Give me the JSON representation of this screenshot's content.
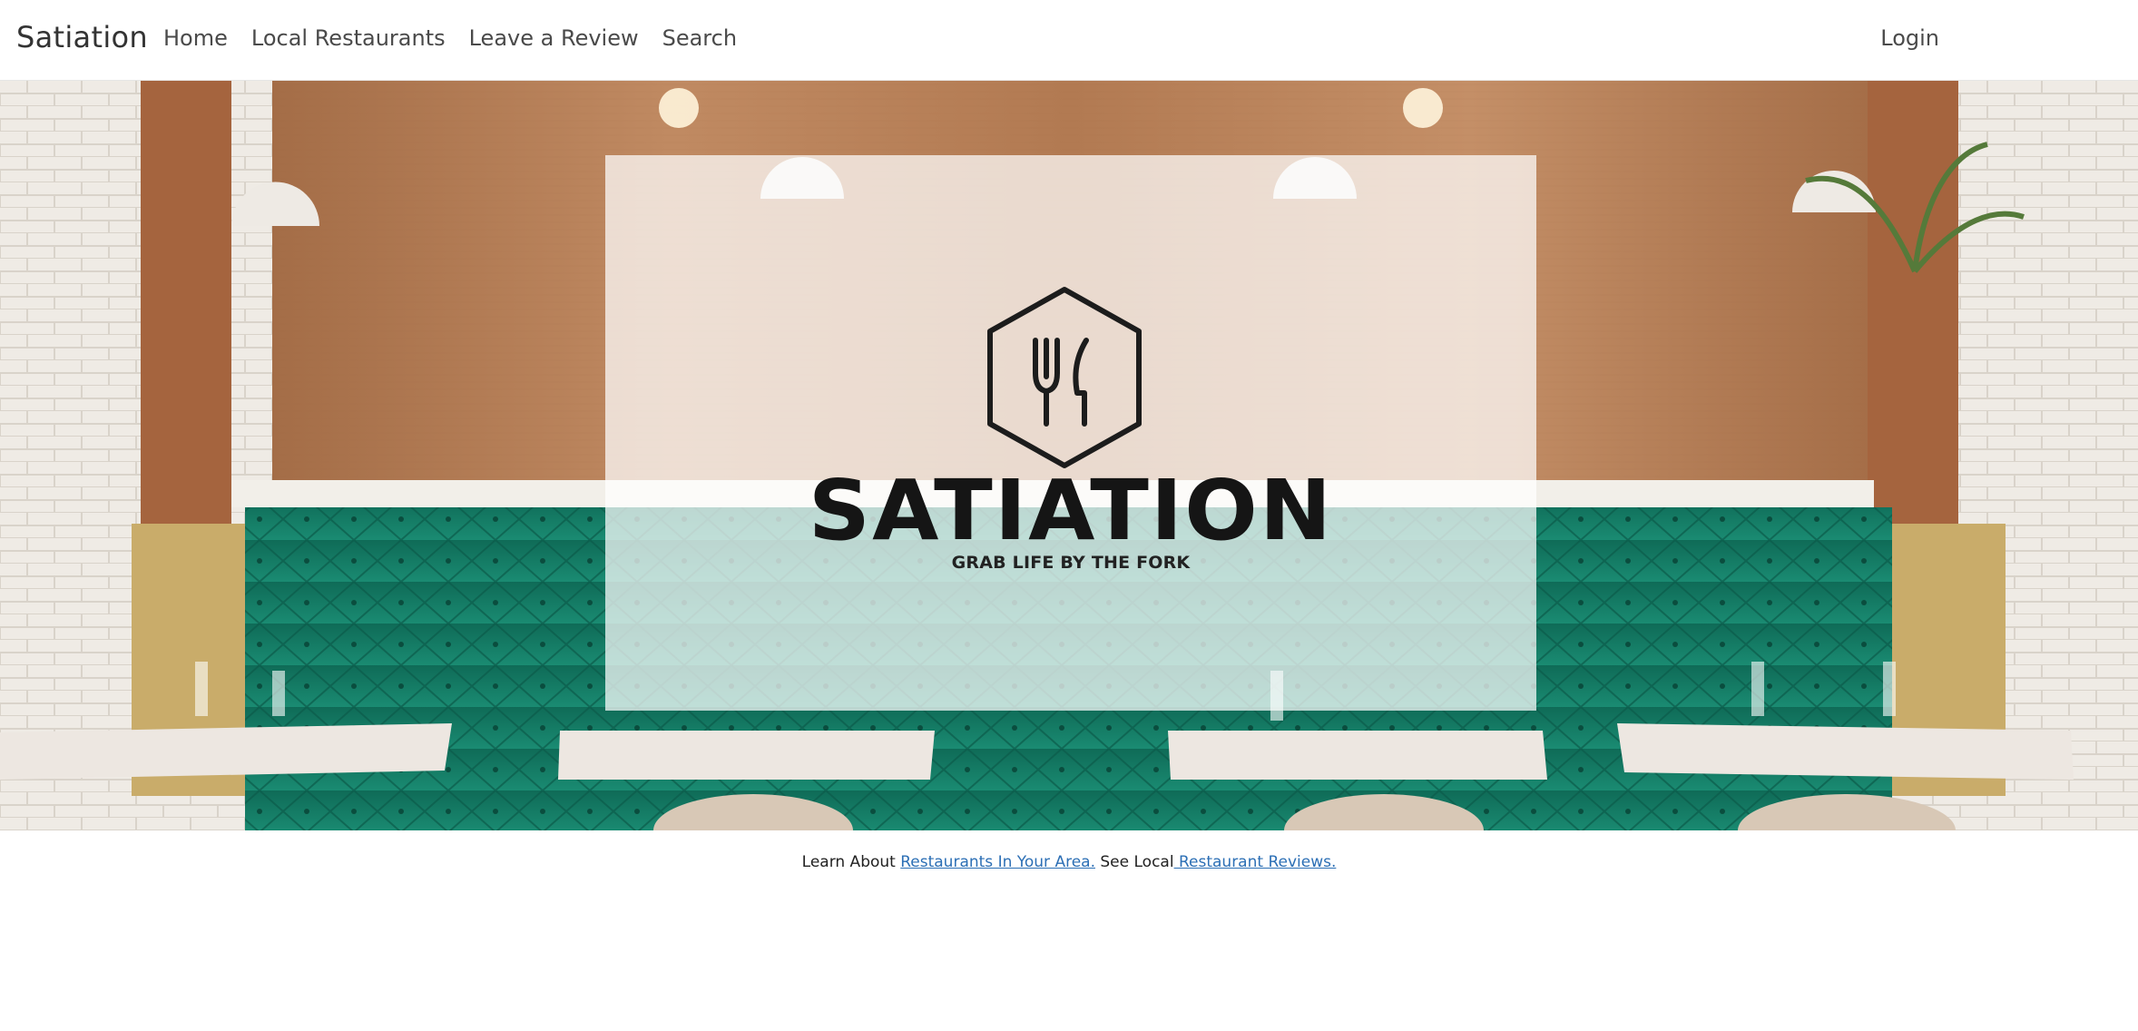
{
  "navbar": {
    "brand": "Satiation",
    "links": [
      "Home",
      "Local Restaurants",
      "Leave a Review",
      "Search"
    ],
    "login": "Login"
  },
  "hero": {
    "logo_text": "SATIATION",
    "tagline": "GRAB LIFE BY THE FORK",
    "icon": "fork-knife-hexagon-icon"
  },
  "intro": {
    "prefix": "Learn About ",
    "link1": "Restaurants In Your Area.",
    "middle": " See Local",
    "link2": " Restaurant Reviews."
  },
  "colors": {
    "wood": "#b27a52",
    "velvet": "#157a64",
    "brick": "#eeeae4",
    "link": "#2c6fb5"
  }
}
